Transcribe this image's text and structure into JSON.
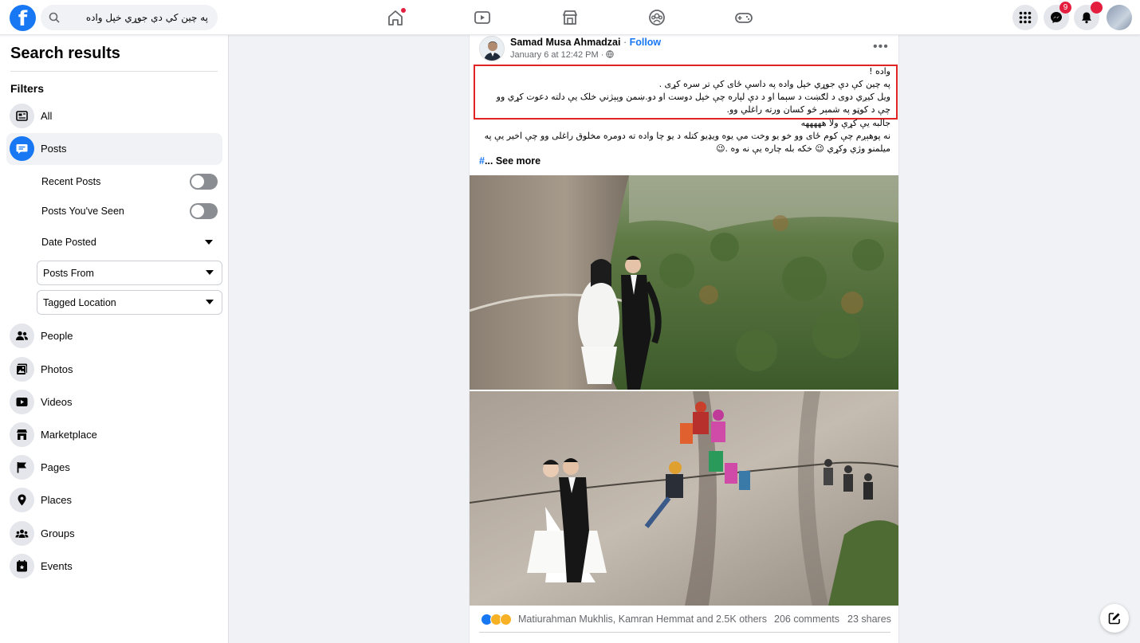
{
  "topbar": {
    "search_value": "په چين کې دې جوړي خپل واده",
    "messenger_badge": "9",
    "notifications_badge": ""
  },
  "sidebar": {
    "title": "Search results",
    "filters_heading": "Filters",
    "items_top": [
      {
        "label": "All",
        "icon": "feed-icon"
      },
      {
        "label": "Posts",
        "icon": "posts-icon",
        "active": true
      }
    ],
    "post_filters": {
      "recent_posts": "Recent Posts",
      "posts_seen": "Posts You've Seen",
      "date_posted": "Date Posted",
      "posts_from": "Posts From",
      "tagged_location": "Tagged Location"
    },
    "items_bottom": [
      {
        "label": "People",
        "icon": "people-icon"
      },
      {
        "label": "Photos",
        "icon": "photos-icon"
      },
      {
        "label": "Videos",
        "icon": "videos-icon"
      },
      {
        "label": "Marketplace",
        "icon": "marketplace-icon"
      },
      {
        "label": "Pages",
        "icon": "flag-icon"
      },
      {
        "label": "Places",
        "icon": "pin-icon"
      },
      {
        "label": "Groups",
        "icon": "groups-icon"
      },
      {
        "label": "Events",
        "icon": "events-icon"
      }
    ]
  },
  "post": {
    "author": "Samad Musa Ahmadzai",
    "separator": " · ",
    "follow": "Follow",
    "date": "January 6 at 12:42 PM · ",
    "lines": [
      "واده !",
      "په چين کې دې جوړي خپل واده په داسې ځای کې تر سره کړی .",
      "ویل کیږي دوی د لګښت د سېما او د دې لپاره چې خپل دوست او دو.ښمن وپېژني خلک یې دلته دعوت کړي وو",
      "چې د کوټو په شمېر څو کسان ورته راغلي وو.",
      "جالبه یې کړې ولا هههههه",
      "نه پوهېږم چې کوم ځای وو خو يو وخت مي یوه ویډیو کتله د یو چا واده ته دومره مخلوق راغلی وو چې اخیر یې په",
      "میلمنو وژي وکړي 😉 خکه بله چاره یې نه وه .😉"
    ],
    "see_more_hash": "#",
    "see_more": "... See more",
    "reactions_text": "Matiurahman Mukhlis, Kamran Hemmat and 2.5K others",
    "comments": "206 comments",
    "shares": "23 shares"
  }
}
